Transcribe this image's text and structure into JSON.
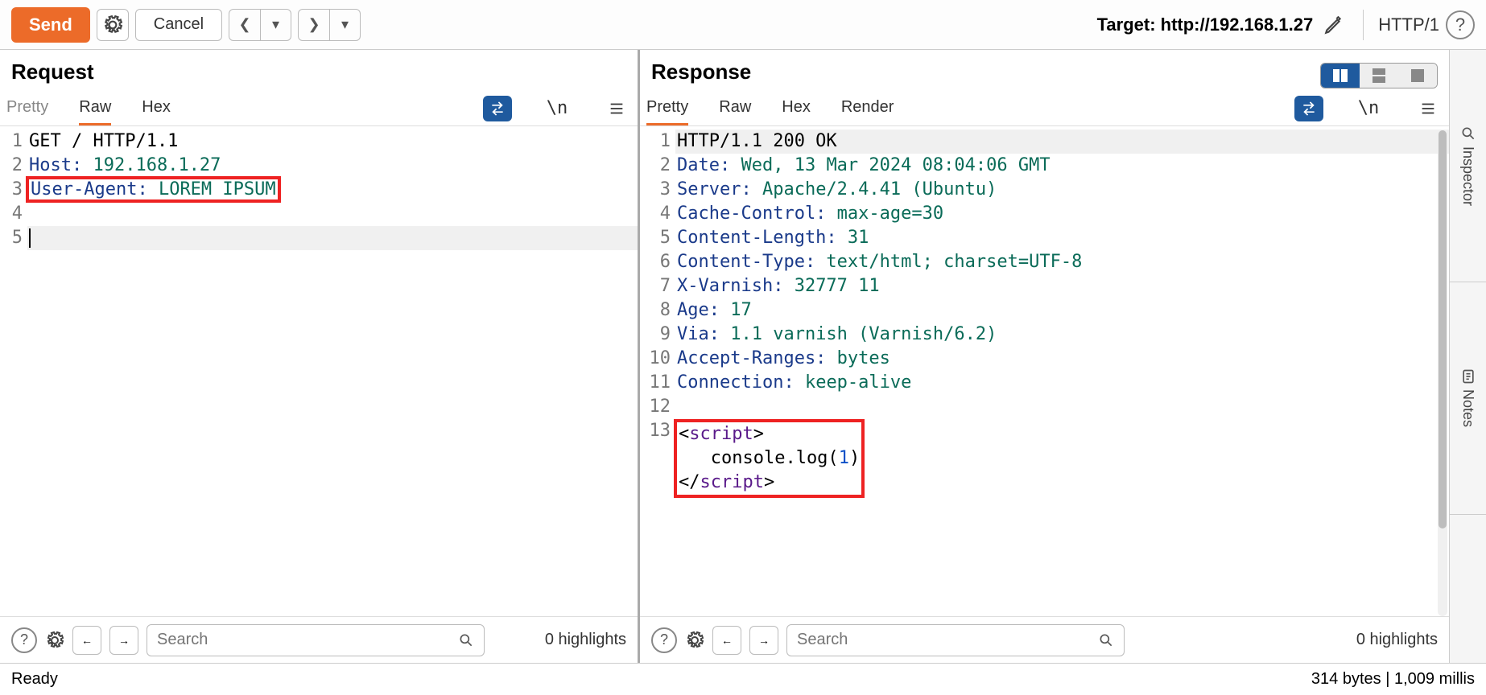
{
  "toolbar": {
    "send": "Send",
    "cancel": "Cancel",
    "target_label": "Target:",
    "target_value": "http://192.168.1.27",
    "http_version": "HTTP/1"
  },
  "request": {
    "title": "Request",
    "tabs": {
      "pretty": "Pretty",
      "raw": "Raw",
      "hex": "Hex"
    },
    "active_tab": "raw",
    "lines": [
      {
        "n": "1",
        "raw": "GET / HTTP/1.1"
      },
      {
        "n": "2",
        "key": "Host:",
        "val": " 192.168.1.27"
      },
      {
        "n": "3",
        "key": "User-Agent:",
        "val": " LOREM IPSUM",
        "boxed": true
      },
      {
        "n": "4",
        "raw": ""
      },
      {
        "n": "5",
        "raw": "",
        "cursor": true
      }
    ],
    "search_placeholder": "Search",
    "highlights": "0 highlights"
  },
  "response": {
    "title": "Response",
    "tabs": {
      "pretty": "Pretty",
      "raw": "Raw",
      "hex": "Hex",
      "render": "Render"
    },
    "active_tab": "pretty",
    "lines": [
      {
        "n": "1",
        "raw": "HTTP/1.1 200 OK",
        "cursor": true
      },
      {
        "n": "2",
        "key": "Date:",
        "val": " Wed, 13 Mar 2024 08:04:06 GMT"
      },
      {
        "n": "3",
        "key": "Server:",
        "val": " Apache/2.4.41 (Ubuntu)"
      },
      {
        "n": "4",
        "key": "Cache-Control:",
        "val": " max-age=30"
      },
      {
        "n": "5",
        "key": "Content-Length:",
        "val": " 31"
      },
      {
        "n": "6",
        "key": "Content-Type:",
        "val": " text/html; charset=UTF-8"
      },
      {
        "n": "7",
        "key": "X-Varnish:",
        "val": " 32777 11"
      },
      {
        "n": "8",
        "key": "Age:",
        "val": " 17"
      },
      {
        "n": "9",
        "key": "Via:",
        "val": " 1.1 varnish (Varnish/6.2)"
      },
      {
        "n": "10",
        "key": "Accept-Ranges:",
        "val": " bytes"
      },
      {
        "n": "11",
        "key": "Connection:",
        "val": " keep-alive"
      },
      {
        "n": "12",
        "raw": ""
      }
    ],
    "script_block": {
      "n": "13",
      "open_a": "<",
      "open_b": "script",
      "open_c": ">",
      "body_a": "   console.log(",
      "body_b": "1",
      "body_c": ")",
      "close_a": "</",
      "close_b": "script",
      "close_c": ">"
    },
    "search_placeholder": "Search",
    "highlights": "0 highlights"
  },
  "rail": {
    "inspector": "Inspector",
    "notes": "Notes"
  },
  "status": {
    "left": "Ready",
    "right": "314 bytes | 1,009 millis"
  }
}
